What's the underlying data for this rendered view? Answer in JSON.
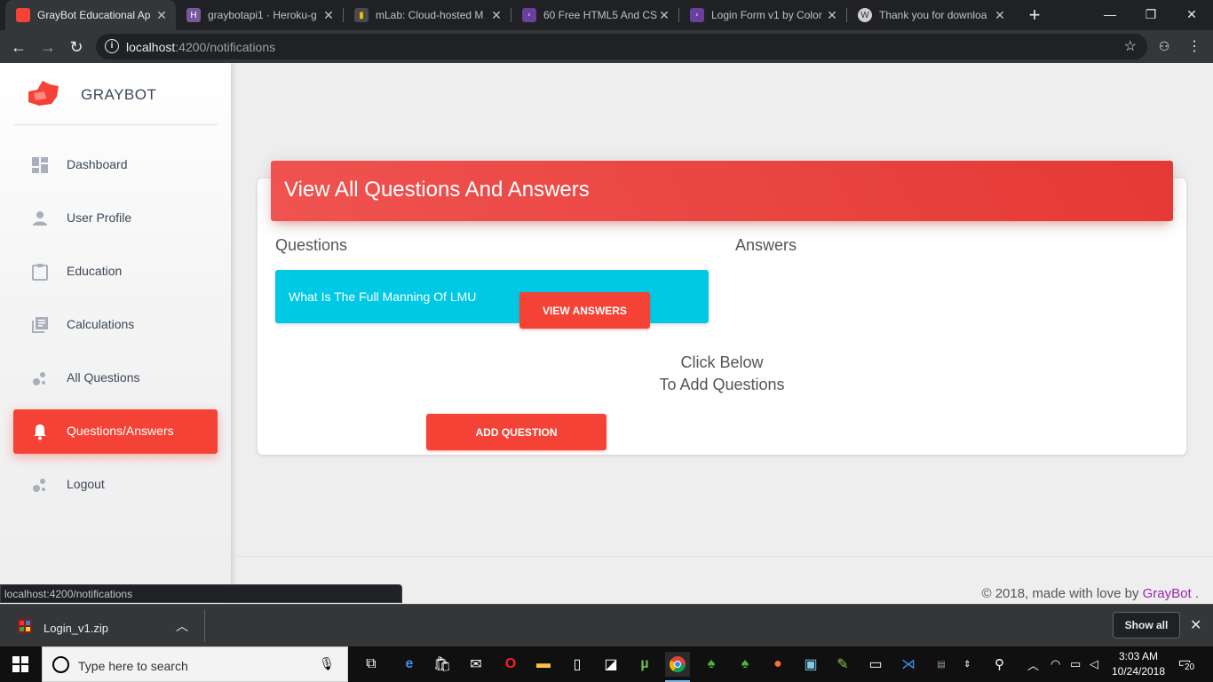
{
  "browser": {
    "tabs": [
      {
        "title": "GrayBot Educational Ap",
        "favicon_color": "#f44336",
        "active": true
      },
      {
        "title": "graybotapi1 · Heroku-g",
        "favicon_color": "#79589f",
        "active": false
      },
      {
        "title": "mLab: Cloud-hosted M",
        "favicon_color": "#4a4a4a",
        "active": false
      },
      {
        "title": "60 Free HTML5 And CS",
        "favicon_color": "#6b3fa0",
        "active": false
      },
      {
        "title": "Login Form v1 by Color",
        "favicon_color": "#6b3fa0",
        "active": false
      },
      {
        "title": "Thank you for downloa",
        "favicon_color": "#d0d0d0",
        "active": false
      }
    ],
    "url_host": "localhost",
    "url_path": ":4200/notifications",
    "status_url": "localhost:4200/notifications"
  },
  "sidebar": {
    "brand": "GRAYBOT",
    "items": [
      {
        "label": "Dashboard",
        "icon": "dashboard-icon",
        "active": false
      },
      {
        "label": "User Profile",
        "icon": "person-icon",
        "active": false
      },
      {
        "label": "Education",
        "icon": "clipboard-icon",
        "active": false
      },
      {
        "label": "Calculations",
        "icon": "library-books-icon",
        "active": false
      },
      {
        "label": "All Questions",
        "icon": "bubbles-icon",
        "active": false
      },
      {
        "label": "Questions/Answers",
        "icon": "bell-icon",
        "active": true
      },
      {
        "label": "Logout",
        "icon": "bubbles-icon",
        "active": false
      }
    ]
  },
  "main": {
    "card_title": "View All Questions And Answers",
    "questions_header": "Questions",
    "answers_header": "Answers",
    "question_text": "What Is The Full Manning Of LMU",
    "view_answers_label": "VIEW ANSWERS",
    "click_below_line1": "Click Below",
    "click_below_line2": "To Add Questions",
    "add_question_label": "ADD QUESTION",
    "footer_prefix": "© 2018, made with love by ",
    "footer_link": "GrayBot",
    "footer_suffix": " ."
  },
  "download": {
    "file_name": "Login_v1.zip",
    "show_all": "Show all"
  },
  "taskbar": {
    "search_placeholder": "Type here to search",
    "time": "3:03 AM",
    "date": "10/24/2018",
    "notification_count": "20"
  },
  "colors": {
    "accent_red": "#f44336",
    "cyan": "#00c9e6",
    "link_purple": "#9c27b0"
  }
}
